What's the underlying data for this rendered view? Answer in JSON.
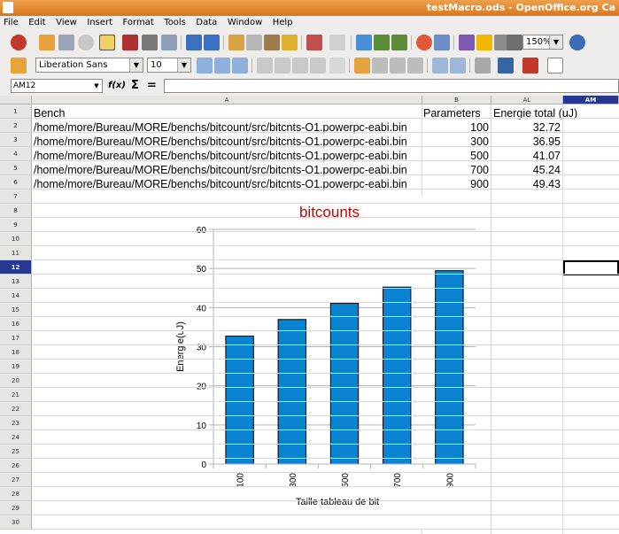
{
  "window": {
    "title": "testMacro.ods - OpenOffice.org Ca"
  },
  "menu": [
    "File",
    "Edit",
    "View",
    "Insert",
    "Format",
    "Tools",
    "Data",
    "Window",
    "Help"
  ],
  "toolbar": {
    "zoom": "150%",
    "font_name": "Liberation Sans",
    "font_size": "10"
  },
  "formula_bar": {
    "name_box": "AM12",
    "fx_icon": "f(x)",
    "sum_icon": "Σ",
    "equals_icon": "=",
    "formula": ""
  },
  "columns": [
    {
      "id": "corner",
      "label": ""
    },
    {
      "id": "A",
      "label": "A"
    },
    {
      "id": "B",
      "label": "B"
    },
    {
      "id": "AL",
      "label": "AL"
    },
    {
      "id": "AM",
      "label": "AM"
    }
  ],
  "rows": [
    "1",
    "2",
    "3",
    "4",
    "5",
    "6",
    "7",
    "8",
    "9",
    "10",
    "11",
    "12",
    "13",
    "14",
    "15",
    "16",
    "17",
    "18",
    "19",
    "20",
    "21",
    "22",
    "23",
    "24",
    "25",
    "26",
    "27",
    "28",
    "29",
    "30"
  ],
  "selected_row": "12",
  "selected_col": "AM",
  "cells": [
    {
      "a": "Bench",
      "b": "Parameters",
      "al": "Energie total (uJ)"
    },
    {
      "a": "/home/more/Bureau/MORE/benchs/bitcount/src/bitcnts-O1.powerpc-eabi.bin",
      "b": "100",
      "al": "32.72"
    },
    {
      "a": "/home/more/Bureau/MORE/benchs/bitcount/src/bitcnts-O1.powerpc-eabi.bin",
      "b": "300",
      "al": "36.95"
    },
    {
      "a": "/home/more/Bureau/MORE/benchs/bitcount/src/bitcnts-O1.powerpc-eabi.bin",
      "b": "500",
      "al": "41.07"
    },
    {
      "a": "/home/more/Bureau/MORE/benchs/bitcount/src/bitcnts-O1.powerpc-eabi.bin",
      "b": "700",
      "al": "45.24"
    },
    {
      "a": "/home/more/Bureau/MORE/benchs/bitcount/src/bitcnts-O1.powerpc-eabi.bin",
      "b": "900",
      "al": "49.43"
    }
  ],
  "chart_data": {
    "type": "bar",
    "title": "bitcounts",
    "xlabel": "Taille tableau de bit",
    "ylabel": "Energie(uJ)",
    "categories": [
      "100",
      "300",
      "500",
      "700",
      "900"
    ],
    "values": [
      32.72,
      36.95,
      41.07,
      45.24,
      49.43
    ],
    "ylim": [
      0,
      60
    ],
    "yticks": [
      0,
      10,
      20,
      30,
      40,
      50,
      60
    ],
    "grid": true,
    "bar_color": "#0a83d2",
    "title_color": "#cc0000"
  }
}
